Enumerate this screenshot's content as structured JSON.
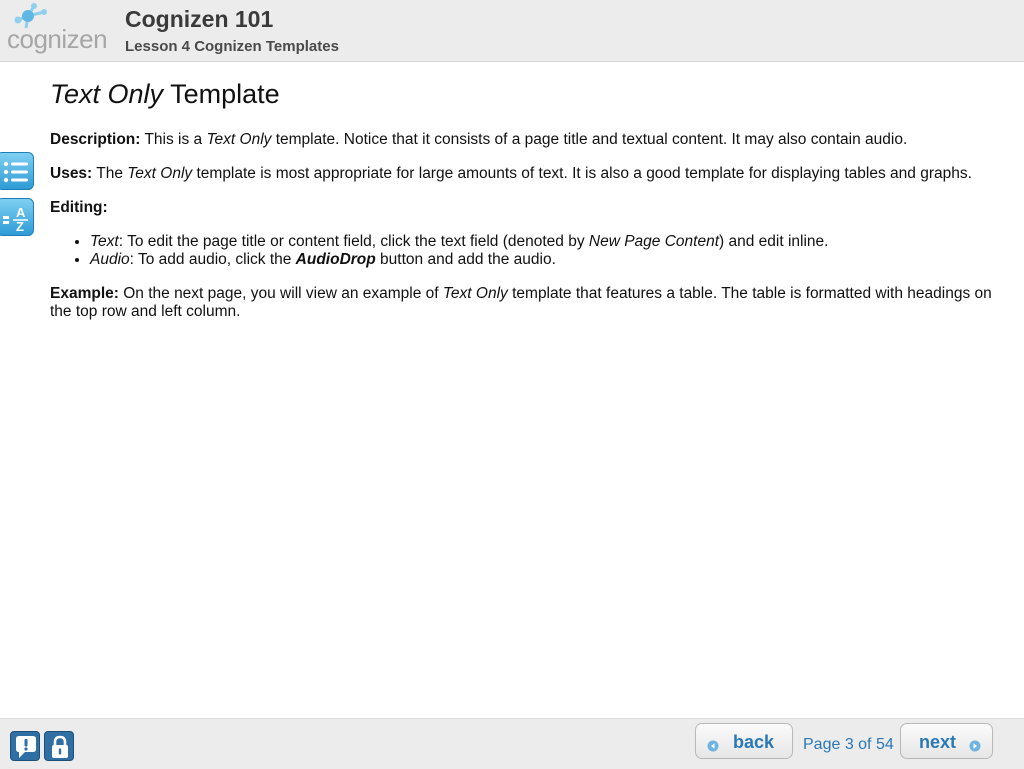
{
  "header": {
    "logo_text": "cognizen",
    "course_title": "Cognizen 101",
    "lesson_title": "Lesson 4 Cognizen Templates"
  },
  "sidebar": {
    "tools": [
      {
        "name": "outline-list-icon"
      },
      {
        "name": "glossary-az-icon"
      }
    ]
  },
  "page": {
    "title_italic": "Text Only",
    "title_rest": " Template",
    "description": {
      "label": "Description:",
      "before": " This is a ",
      "italic": "Text Only",
      "after": " template. Notice that it consists of a page title and textual content. It may also contain audio."
    },
    "uses": {
      "label": "Uses:",
      "before": " The ",
      "italic": "Text Only",
      "after": " template is most appropriate for large amounts of text. It is also a good template for displaying tables and graphs."
    },
    "editing": {
      "label": "Editing:",
      "items": [
        {
          "italic": "Text",
          "before": ": To edit the page title or content field, click the text field (denoted by ",
          "italic2": "New Page Content",
          "after": ") and edit inline."
        },
        {
          "italic": "Audio",
          "before": ": To add audio, click the ",
          "bolditalic": "AudioDrop",
          "after": " button and add the audio."
        }
      ]
    },
    "example": {
      "label": "Example:",
      "before": " On the next page, you will view an example of ",
      "italic": "Text Only",
      "after": " template that features a table. The table is formatted with headings on the top row and left column."
    }
  },
  "footer": {
    "back_label": "back",
    "next_label": "next",
    "page_indicator": "Page 3 of 54",
    "icons": [
      "help-icon",
      "lock-icon"
    ]
  },
  "colors": {
    "accent_blue": "#2a78b8",
    "header_bg": "#ececec",
    "tool_blue": "#2d9bd6",
    "footer_icon_blue": "#2f6fa4"
  }
}
